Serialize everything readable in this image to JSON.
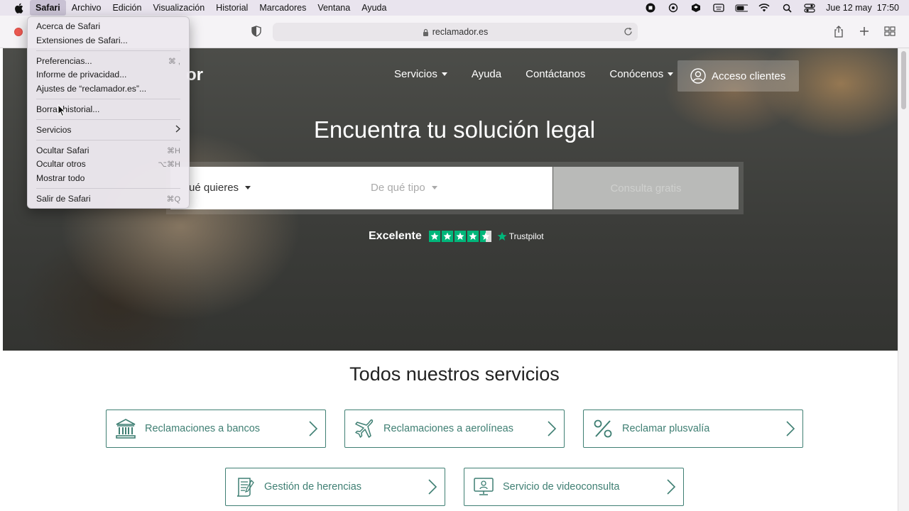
{
  "menubar": {
    "items": [
      {
        "label": "Safari",
        "active": true
      },
      {
        "label": "Archivo"
      },
      {
        "label": "Edición"
      },
      {
        "label": "Visualización"
      },
      {
        "label": "Historial"
      },
      {
        "label": "Marcadores"
      },
      {
        "label": "Ventana"
      },
      {
        "label": "Ayuda"
      }
    ],
    "clock": "Jue 12 may  17:50"
  },
  "toolbar": {
    "url": "reclamador.es"
  },
  "app_menu": {
    "items": [
      {
        "label": "Acerca de Safari",
        "shortcut": ""
      },
      {
        "label": "Extensiones de Safari...",
        "shortcut": ""
      },
      {
        "label": "Preferencias...",
        "shortcut": "⌘ ,"
      },
      {
        "label": "Informe de privacidad...",
        "shortcut": ""
      },
      {
        "label": "Ajustes de “reclamador.es”...",
        "shortcut": ""
      },
      {
        "label": "Borrar historial...",
        "shortcut": ""
      },
      {
        "label": "Servicios",
        "shortcut": ""
      },
      {
        "label": "Ocultar Safari",
        "shortcut": "⌘H"
      },
      {
        "label": "Ocultar otros",
        "shortcut": "⌥⌘H"
      },
      {
        "label": "Mostrar todo",
        "shortcut": ""
      },
      {
        "label": "Salir de Safari",
        "shortcut": "⌘Q"
      }
    ]
  },
  "hero": {
    "logo_fragment": "or",
    "nav": [
      {
        "label": "Servicios"
      },
      {
        "label": "Ayuda"
      },
      {
        "label": "Contáctanos"
      },
      {
        "label": "Conócenos"
      }
    ],
    "acceso_label": "Acceso clientes",
    "title": "Encuentra tu solución legal",
    "select_what": "ué quieres",
    "select_type": "De qué tipo",
    "submit_label": "Consulta gratis",
    "trust_label": "Excelente",
    "trustpilot_label": "Trustpilot",
    "rating_stars": 4.5
  },
  "services": {
    "title": "Todos nuestros servicios",
    "items": [
      {
        "label": "Reclamaciones a bancos",
        "icon": "bank-icon"
      },
      {
        "label": "Reclamaciones a aerolíneas",
        "icon": "airplane-icon"
      },
      {
        "label": "Reclamar plusvalía",
        "icon": "percent-icon"
      },
      {
        "label": "Gestión de herencias",
        "icon": "document-icon"
      },
      {
        "label": "Servicio de videoconsulta",
        "icon": "monitor-icon"
      }
    ]
  },
  "colors": {
    "accent": "#3f7f73",
    "trustpilot_green": "#00b67a"
  }
}
